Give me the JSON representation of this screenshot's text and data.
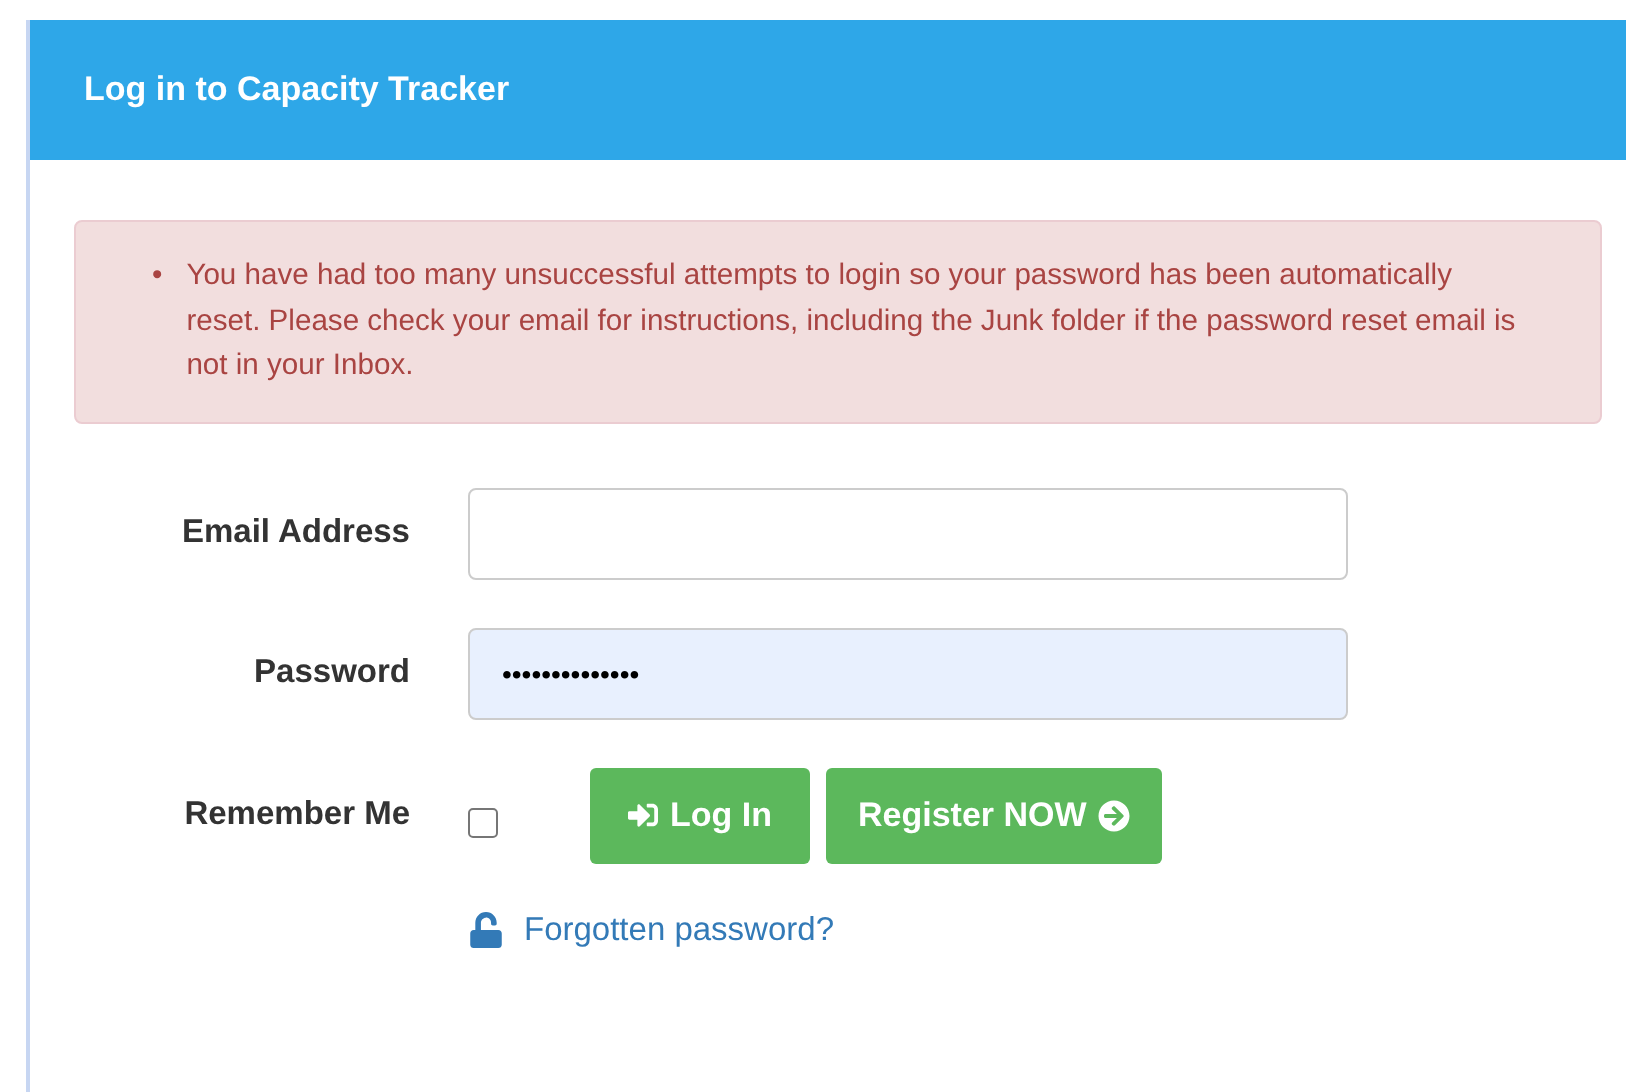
{
  "panel": {
    "title": "Log in to Capacity Tracker"
  },
  "errors": [
    {
      "bullet": "•",
      "text": "You have had too many unsuccessful attempts to login so your password has been automatically reset. Please check your email for instructions, including the Junk folder if the password reset email is not in your Inbox."
    }
  ],
  "fields": [
    {
      "label": "Email Address",
      "autofilled": false
    },
    {
      "label": "Password",
      "value": "••••••••••••••",
      "autofilled": true
    }
  ],
  "remember": {
    "label": "Remember Me",
    "checked": false
  },
  "buttons": [
    {
      "kind": "login",
      "label": "Log In"
    },
    {
      "kind": "register",
      "label": "Register NOW"
    }
  ],
  "forgot_link": "Forgotten password?"
}
